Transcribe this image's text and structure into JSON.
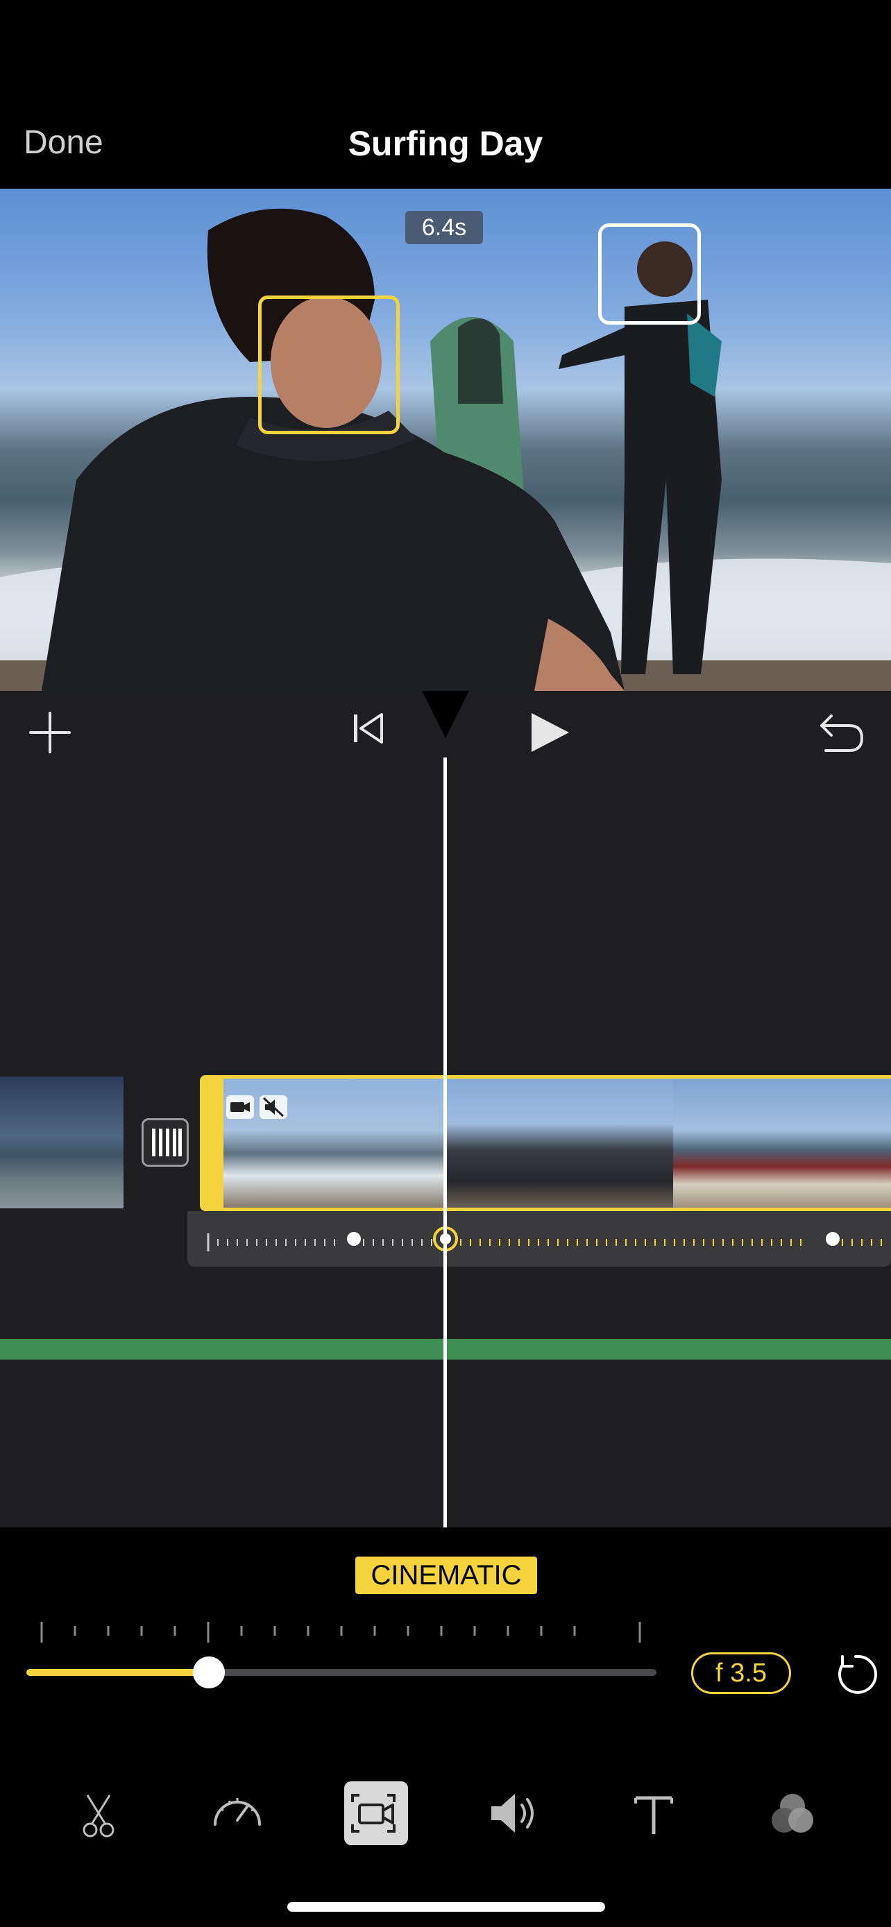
{
  "header": {
    "done_label": "Done",
    "title": "Surfing Day"
  },
  "viewer": {
    "time_badge": "6.4s"
  },
  "controls": {
    "add_icon": "plus-icon",
    "skip_back_icon": "skip-to-start-icon",
    "play_icon": "play-icon",
    "undo_icon": "undo-icon"
  },
  "timeline": {
    "transition_icon": "transition-icon",
    "clip_icons": [
      "cinematic-camera-icon",
      "muted-speaker-icon"
    ]
  },
  "bottom": {
    "mode_label": "CINEMATIC",
    "aperture_value": "f 3.5",
    "depth_slider_fraction": 0.29,
    "reset_icon": "reset-icon",
    "tools": [
      {
        "name": "scissors-icon",
        "active": false
      },
      {
        "name": "speed-icon",
        "active": false
      },
      {
        "name": "cinematic-icon",
        "active": true
      },
      {
        "name": "volume-icon",
        "active": false
      },
      {
        "name": "text-icon",
        "active": false
      },
      {
        "name": "filters-icon",
        "active": false
      }
    ]
  },
  "colors": {
    "accent": "#f5d33c",
    "audio_track": "#3f8f55",
    "background": "#1e1e20"
  }
}
